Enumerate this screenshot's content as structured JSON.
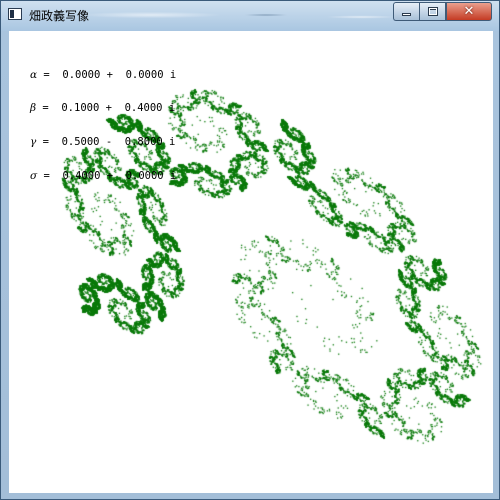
{
  "window": {
    "title": "畑政義写像",
    "controls": {
      "minimize_icon": "minimize-icon",
      "maximize_icon": "maximize-icon",
      "close_glyph": "✕"
    }
  },
  "parameters": [
    {
      "symbol": "α",
      "text": " =  0.0000 +  0.0000 i"
    },
    {
      "symbol": "β",
      "text": " =  0.1000 +  0.4000 i"
    },
    {
      "symbol": "γ",
      "text": " =  0.5000 -  0.8000 i"
    },
    {
      "symbol": "σ",
      "text": " =  0.4000 +  0.0000 i"
    }
  ],
  "fractal": {
    "color": "#0b7a0b",
    "alpha": [
      0.0,
      0.0
    ],
    "beta": [
      0.1,
      0.4
    ],
    "gamma": [
      0.5,
      -0.8
    ],
    "sigma": [
      0.4,
      0.0
    ]
  },
  "colors": {
    "titlebar": "#b9d1e8",
    "close_button": "#c53b24",
    "client_background": "#ffffff"
  }
}
